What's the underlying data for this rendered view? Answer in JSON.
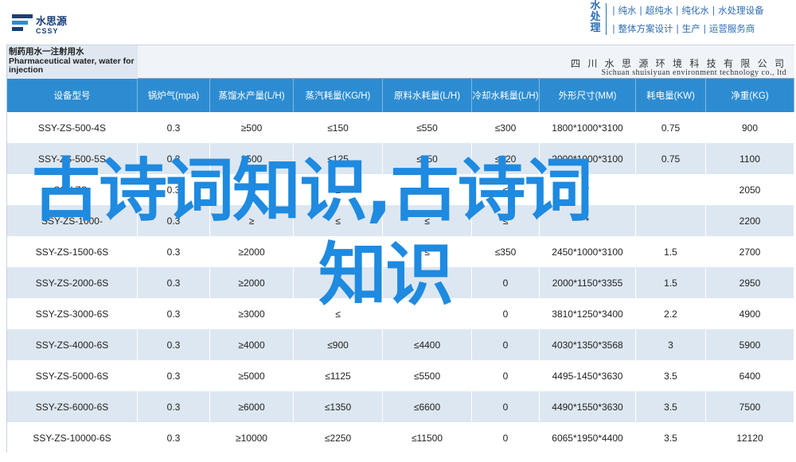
{
  "logo": {
    "cn": "水思源",
    "en": "CSSY"
  },
  "brand": {
    "vertical": "水处理",
    "line1": "| 纯水 | 超纯水 | 纯化水 | 水处理设备",
    "line2": "| 整体方案设计 | 生产 | 运营服务商"
  },
  "table": {
    "title": "制药用水一注射用水 Pharmaceutical water, water for injection",
    "company_cn": "四 川 水 思 源 环 境 科 技 有 限 公 司",
    "company_en": "Sichuan shuisiyuan environment technology co., ltd",
    "headers": [
      "设备型号",
      "锅炉气(mpa)",
      "蒸馏水产量(L/H)",
      "蒸汽耗量(KG/H)",
      "原料水耗量(L/H)",
      "冷却水耗量(L/H)",
      "外形尺寸(MM)",
      "耗电量(KW)",
      "净重(KG)"
    ],
    "rows": [
      [
        "SSY-ZS-500-4S",
        "0.3",
        "≥500",
        "≤150",
        "≤550",
        "≤300",
        "1800*1000*3100",
        "0.75",
        "900"
      ],
      [
        "SSY-ZS-500-5S",
        "0.3",
        "≥500",
        "≤125",
        "≤550",
        "≤120",
        "2000*1000*3100",
        "0.75",
        "1100"
      ],
      [
        "SSY-ZS-",
        "0.3",
        "≥",
        "≤",
        "≤",
        "≤",
        "*",
        "",
        "2050"
      ],
      [
        "SSY-ZS-1000-",
        "0.3",
        "≥",
        "≤",
        "≤",
        "≤",
        "*",
        "",
        "2200"
      ],
      [
        "SSY-ZS-1500-6S",
        "0.3",
        "≥2000",
        "≤",
        "≤",
        "≤350",
        "2450*1000*3100",
        "1.5",
        "2700"
      ],
      [
        "SSY-ZS-2000-6S",
        "0.3",
        "≥2000",
        "≤",
        "",
        "0",
        "2000*1150*3355",
        "1.5",
        "2950"
      ],
      [
        "SSY-ZS-3000-6S",
        "0.3",
        "≥3000",
        "≤",
        "",
        "0",
        "3810*1250*3400",
        "2.2",
        "4900"
      ],
      [
        "SSY-ZS-4000-6S",
        "0.3",
        "≥4000",
        "≤900",
        "≤4400",
        "0",
        "4030*1350*3568",
        "3",
        "5900"
      ],
      [
        "SSY-ZS-5000-6S",
        "0.3",
        "≥5000",
        "≤1125",
        "≤5500",
        "0",
        "4495-1450*3630",
        "3.5",
        "6400"
      ],
      [
        "SSY-ZS-6000-6S",
        "0.3",
        "≥6000",
        "≤1350",
        "≤6600",
        "0",
        "4490*1550*3630",
        "3.5",
        "7500"
      ],
      [
        "SSY-ZS-10000-6S",
        "0.3",
        "≥10000",
        "≤2250",
        "≤11500",
        "0",
        "6065*1950*4400",
        "3.5",
        "12120"
      ]
    ]
  },
  "overlay": {
    "line1": "古诗词知识,古诗词",
    "line2": "知识"
  }
}
